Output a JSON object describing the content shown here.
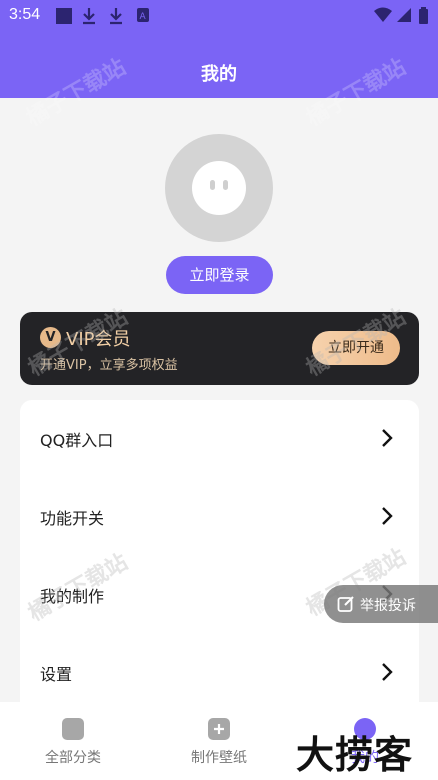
{
  "status": {
    "time": "3:54"
  },
  "header": {
    "title": "我的"
  },
  "profile": {
    "login_label": "立即登录"
  },
  "vip": {
    "badge": "V",
    "title": "VIP会员",
    "subtitle": "开通VIP，立享多项权益",
    "button": "立即开通"
  },
  "menu": {
    "items": [
      {
        "label": "QQ群入口"
      },
      {
        "label": "功能开关"
      },
      {
        "label": "我的制作"
      },
      {
        "label": "设置"
      }
    ]
  },
  "report": {
    "label": "举报投诉"
  },
  "nav": {
    "tabs": [
      {
        "label": "全部分类"
      },
      {
        "label": "制作壁纸"
      },
      {
        "label": "我的"
      }
    ]
  },
  "watermark": {
    "text": "橘子下载站"
  },
  "corner_logo": {
    "text": "大捞客"
  },
  "colors": {
    "primary": "#7b64f5",
    "vip_bg": "#232326",
    "vip_gold": "#f2cfa5"
  }
}
